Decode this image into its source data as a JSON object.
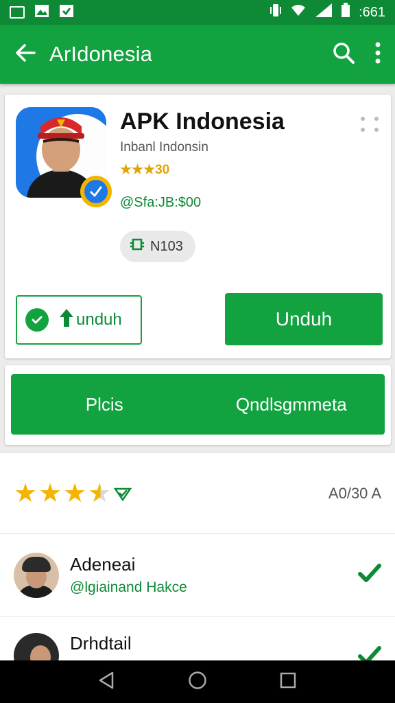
{
  "status_bar": {
    "time": ":661",
    "icons": [
      "screenshot-icon",
      "image-icon",
      "gallery-icon",
      "vibrate-icon",
      "wifi-icon",
      "signal-icon",
      "battery-icon"
    ]
  },
  "app_bar": {
    "title": "ArIdonesia",
    "icons": [
      "back-arrow-icon",
      "search-icon",
      "overflow-menu-icon"
    ]
  },
  "app": {
    "title": "APK Indonesia",
    "developer": "Inbanl Indonsin",
    "rating_text": "★★★30",
    "meta": "@Sfa:JB:$00",
    "chip_label": "N103",
    "secondary_button": "unduh",
    "primary_button": "Unduh"
  },
  "tabs": [
    "Plcis",
    "Qndlsgmmeta"
  ],
  "ratings": {
    "stars": 3.5,
    "count_text": "A0/30 A"
  },
  "reviews": [
    {
      "name": "Adeneai",
      "subtitle": "@lgiainand Hakce"
    },
    {
      "name": "Drhdtail",
      "subtitle": ""
    }
  ],
  "colors": {
    "accent": "#12a23f",
    "status_bar": "#0e8a36",
    "star": "#f4b400"
  }
}
